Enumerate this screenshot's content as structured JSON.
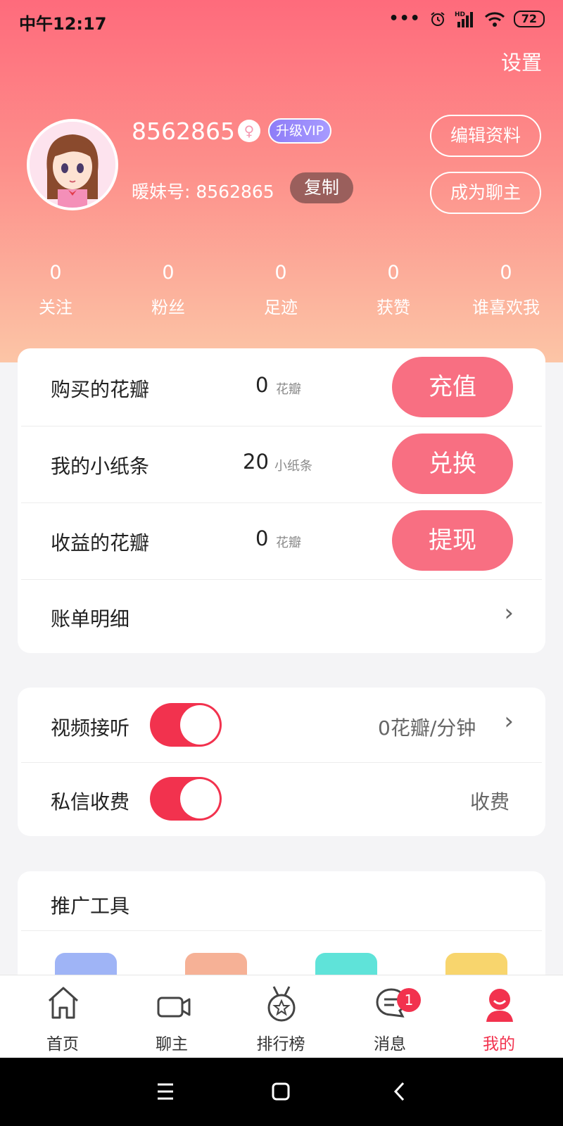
{
  "status_bar": {
    "time": "中午12:17",
    "battery": "72",
    "network": "HD"
  },
  "header": {
    "settings_label": "设置"
  },
  "profile": {
    "name": "8562865",
    "vip_label": "升级VIP",
    "id_text": "暖妹号: 8562865",
    "copy_label": "复制",
    "edit_label": "编辑资料",
    "host_label": "成为聊主"
  },
  "stats": [
    {
      "value": "0",
      "label": "关注"
    },
    {
      "value": "0",
      "label": "粉丝"
    },
    {
      "value": "0",
      "label": "足迹"
    },
    {
      "value": "0",
      "label": "获赞"
    },
    {
      "value": "0",
      "label": "谁喜欢我"
    }
  ],
  "wallet": {
    "rows": [
      {
        "label": "购买的花瓣",
        "value": "0",
        "unit": "花瓣",
        "action": "充值"
      },
      {
        "label": "我的小纸条",
        "value": "20",
        "unit": "小纸条",
        "action": "兑换"
      },
      {
        "label": "收益的花瓣",
        "value": "0",
        "unit": "花瓣",
        "action": "提现"
      }
    ],
    "bill_label": "账单明细"
  },
  "charges": {
    "video": {
      "label": "视频接听",
      "on": true,
      "value": "0花瓣/分钟"
    },
    "message": {
      "label": "私信收费",
      "on": true,
      "value": "收费"
    }
  },
  "promo": {
    "title": "推广工具",
    "icon_colors": [
      "#9fb4f6",
      "#f6b196",
      "#5fe3d9",
      "#f8d56d"
    ]
  },
  "nav": {
    "items": [
      {
        "label": "首页",
        "icon": "home-icon"
      },
      {
        "label": "聊主",
        "icon": "camera-icon"
      },
      {
        "label": "排行榜",
        "icon": "medal-icon"
      },
      {
        "label": "消息",
        "icon": "message-icon",
        "badge": "1"
      },
      {
        "label": "我的",
        "icon": "profile-icon",
        "active": true
      }
    ]
  },
  "colors": {
    "accent": "#f2324e",
    "button": "#f86f82",
    "gradient_top": "#fe6b7c",
    "gradient_bottom": "#fcc5a6"
  }
}
